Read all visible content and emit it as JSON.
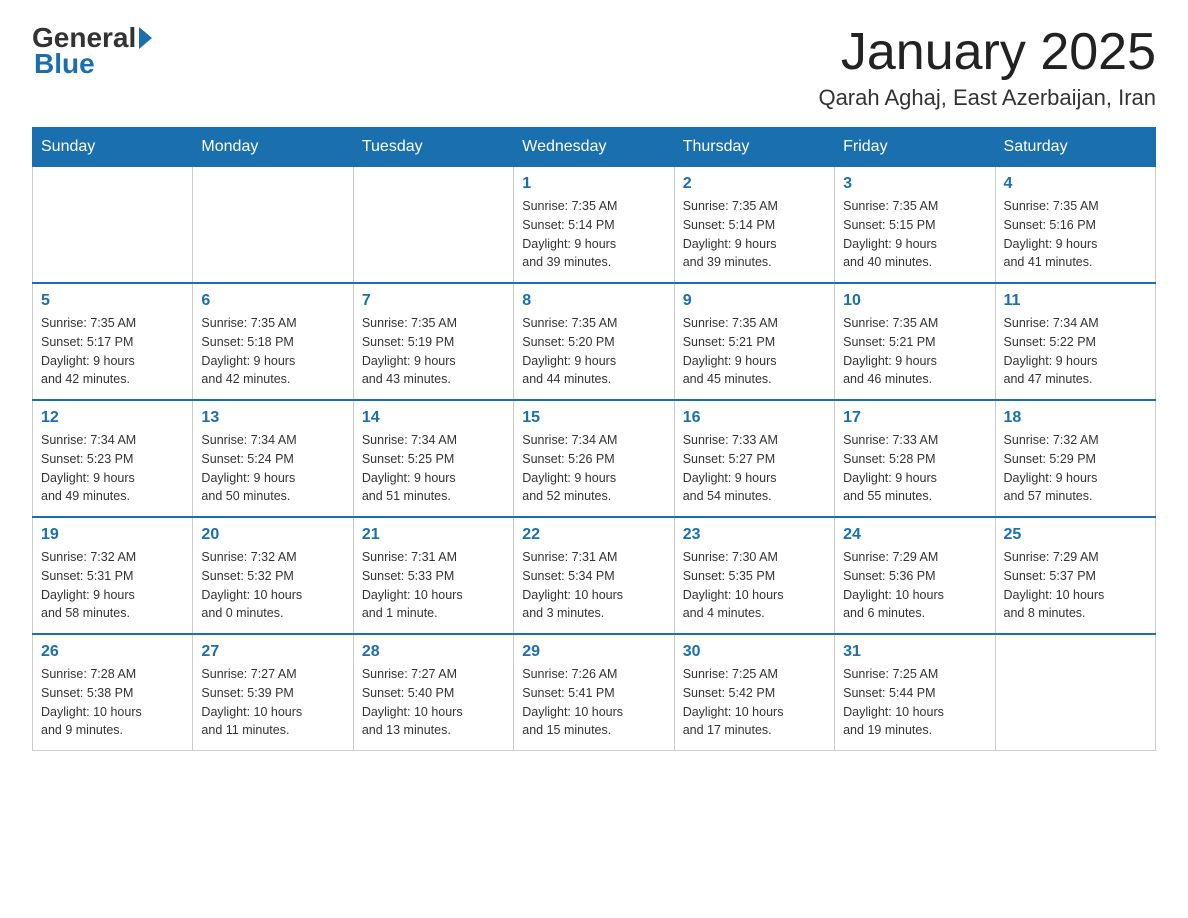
{
  "logo": {
    "general": "General",
    "blue": "Blue"
  },
  "title": "January 2025",
  "subtitle": "Qarah Aghaj, East Azerbaijan, Iran",
  "weekdays": [
    "Sunday",
    "Monday",
    "Tuesday",
    "Wednesday",
    "Thursday",
    "Friday",
    "Saturday"
  ],
  "weeks": [
    [
      {
        "day": "",
        "info": ""
      },
      {
        "day": "",
        "info": ""
      },
      {
        "day": "",
        "info": ""
      },
      {
        "day": "1",
        "info": "Sunrise: 7:35 AM\nSunset: 5:14 PM\nDaylight: 9 hours\nand 39 minutes."
      },
      {
        "day": "2",
        "info": "Sunrise: 7:35 AM\nSunset: 5:14 PM\nDaylight: 9 hours\nand 39 minutes."
      },
      {
        "day": "3",
        "info": "Sunrise: 7:35 AM\nSunset: 5:15 PM\nDaylight: 9 hours\nand 40 minutes."
      },
      {
        "day": "4",
        "info": "Sunrise: 7:35 AM\nSunset: 5:16 PM\nDaylight: 9 hours\nand 41 minutes."
      }
    ],
    [
      {
        "day": "5",
        "info": "Sunrise: 7:35 AM\nSunset: 5:17 PM\nDaylight: 9 hours\nand 42 minutes."
      },
      {
        "day": "6",
        "info": "Sunrise: 7:35 AM\nSunset: 5:18 PM\nDaylight: 9 hours\nand 42 minutes."
      },
      {
        "day": "7",
        "info": "Sunrise: 7:35 AM\nSunset: 5:19 PM\nDaylight: 9 hours\nand 43 minutes."
      },
      {
        "day": "8",
        "info": "Sunrise: 7:35 AM\nSunset: 5:20 PM\nDaylight: 9 hours\nand 44 minutes."
      },
      {
        "day": "9",
        "info": "Sunrise: 7:35 AM\nSunset: 5:21 PM\nDaylight: 9 hours\nand 45 minutes."
      },
      {
        "day": "10",
        "info": "Sunrise: 7:35 AM\nSunset: 5:21 PM\nDaylight: 9 hours\nand 46 minutes."
      },
      {
        "day": "11",
        "info": "Sunrise: 7:34 AM\nSunset: 5:22 PM\nDaylight: 9 hours\nand 47 minutes."
      }
    ],
    [
      {
        "day": "12",
        "info": "Sunrise: 7:34 AM\nSunset: 5:23 PM\nDaylight: 9 hours\nand 49 minutes."
      },
      {
        "day": "13",
        "info": "Sunrise: 7:34 AM\nSunset: 5:24 PM\nDaylight: 9 hours\nand 50 minutes."
      },
      {
        "day": "14",
        "info": "Sunrise: 7:34 AM\nSunset: 5:25 PM\nDaylight: 9 hours\nand 51 minutes."
      },
      {
        "day": "15",
        "info": "Sunrise: 7:34 AM\nSunset: 5:26 PM\nDaylight: 9 hours\nand 52 minutes."
      },
      {
        "day": "16",
        "info": "Sunrise: 7:33 AM\nSunset: 5:27 PM\nDaylight: 9 hours\nand 54 minutes."
      },
      {
        "day": "17",
        "info": "Sunrise: 7:33 AM\nSunset: 5:28 PM\nDaylight: 9 hours\nand 55 minutes."
      },
      {
        "day": "18",
        "info": "Sunrise: 7:32 AM\nSunset: 5:29 PM\nDaylight: 9 hours\nand 57 minutes."
      }
    ],
    [
      {
        "day": "19",
        "info": "Sunrise: 7:32 AM\nSunset: 5:31 PM\nDaylight: 9 hours\nand 58 minutes."
      },
      {
        "day": "20",
        "info": "Sunrise: 7:32 AM\nSunset: 5:32 PM\nDaylight: 10 hours\nand 0 minutes."
      },
      {
        "day": "21",
        "info": "Sunrise: 7:31 AM\nSunset: 5:33 PM\nDaylight: 10 hours\nand 1 minute."
      },
      {
        "day": "22",
        "info": "Sunrise: 7:31 AM\nSunset: 5:34 PM\nDaylight: 10 hours\nand 3 minutes."
      },
      {
        "day": "23",
        "info": "Sunrise: 7:30 AM\nSunset: 5:35 PM\nDaylight: 10 hours\nand 4 minutes."
      },
      {
        "day": "24",
        "info": "Sunrise: 7:29 AM\nSunset: 5:36 PM\nDaylight: 10 hours\nand 6 minutes."
      },
      {
        "day": "25",
        "info": "Sunrise: 7:29 AM\nSunset: 5:37 PM\nDaylight: 10 hours\nand 8 minutes."
      }
    ],
    [
      {
        "day": "26",
        "info": "Sunrise: 7:28 AM\nSunset: 5:38 PM\nDaylight: 10 hours\nand 9 minutes."
      },
      {
        "day": "27",
        "info": "Sunrise: 7:27 AM\nSunset: 5:39 PM\nDaylight: 10 hours\nand 11 minutes."
      },
      {
        "day": "28",
        "info": "Sunrise: 7:27 AM\nSunset: 5:40 PM\nDaylight: 10 hours\nand 13 minutes."
      },
      {
        "day": "29",
        "info": "Sunrise: 7:26 AM\nSunset: 5:41 PM\nDaylight: 10 hours\nand 15 minutes."
      },
      {
        "day": "30",
        "info": "Sunrise: 7:25 AM\nSunset: 5:42 PM\nDaylight: 10 hours\nand 17 minutes."
      },
      {
        "day": "31",
        "info": "Sunrise: 7:25 AM\nSunset: 5:44 PM\nDaylight: 10 hours\nand 19 minutes."
      },
      {
        "day": "",
        "info": ""
      }
    ]
  ]
}
